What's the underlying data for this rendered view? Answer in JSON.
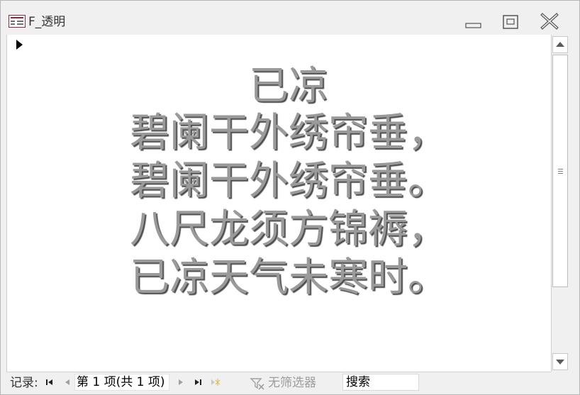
{
  "window": {
    "title": "F_透明",
    "icon": "access-form-icon"
  },
  "titlebar_buttons": {
    "minimize": "minimize-icon",
    "maximize": "maximize-icon",
    "close": "close-icon"
  },
  "form": {
    "poem_title": "已凉",
    "poem_lines": [
      "碧阑干外绣帘垂，",
      "碧阑干外绣帘垂。",
      "八尺龙须方锦褥，",
      "已凉天气未寒时。"
    ],
    "text_color": "#9a9a9a",
    "shadow_color": "#4e4e4e"
  },
  "navigation": {
    "record_label": "记录:",
    "record_position": "第 1 项(共 1 项)",
    "filter_label": "无筛选器",
    "search_placeholder": "搜索",
    "icons": [
      "first-record-icon",
      "previous-record-icon",
      "next-record-icon",
      "last-record-icon",
      "new-record-icon",
      "no-filter-icon"
    ]
  }
}
